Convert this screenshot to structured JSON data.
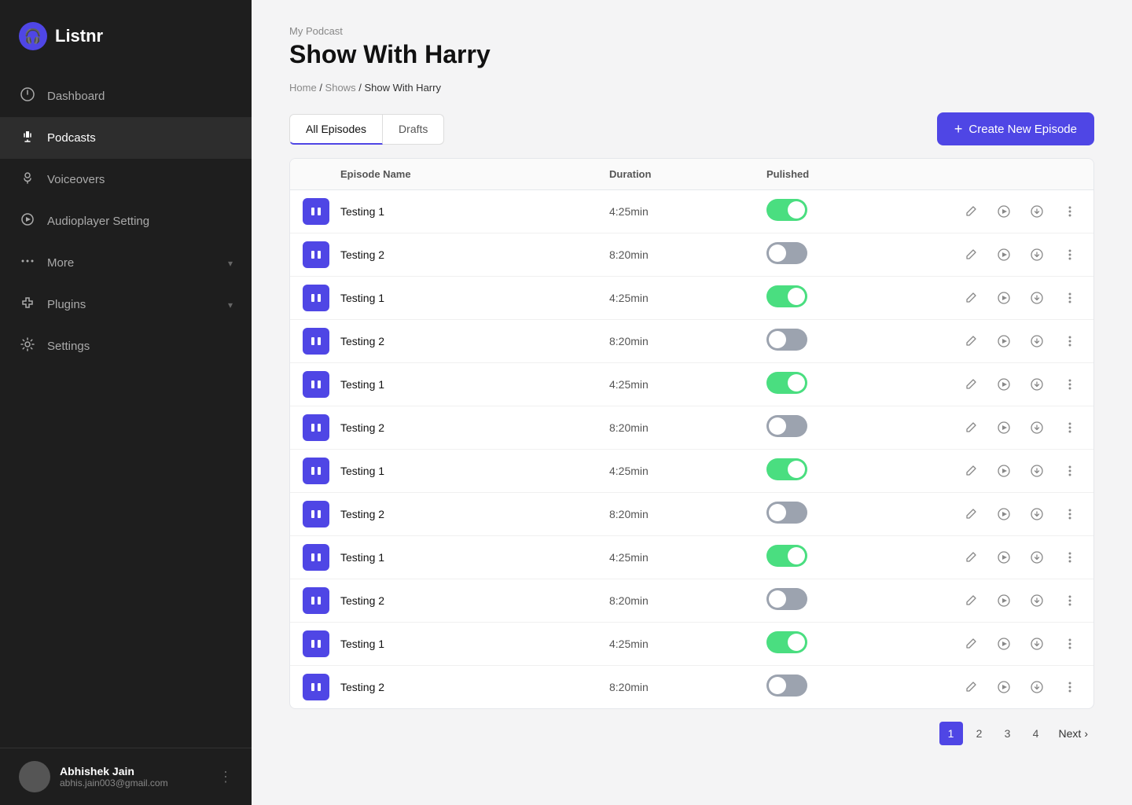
{
  "sidebar": {
    "logo": {
      "icon": "🎧",
      "name": "Listnr"
    },
    "nav_items": [
      {
        "id": "dashboard",
        "label": "Dashboard",
        "icon": "⬡",
        "active": false,
        "has_chevron": false
      },
      {
        "id": "podcasts",
        "label": "Podcasts",
        "icon": "♪",
        "active": true,
        "has_chevron": false
      },
      {
        "id": "voiceovers",
        "label": "Voiceovers",
        "icon": "🎙",
        "active": false,
        "has_chevron": false
      },
      {
        "id": "audioplayer",
        "label": "Audioplayer Setting",
        "icon": "▶",
        "active": false,
        "has_chevron": false
      },
      {
        "id": "more",
        "label": "More",
        "icon": "•••",
        "active": false,
        "has_chevron": true
      },
      {
        "id": "plugins",
        "label": "Plugins",
        "icon": "🔧",
        "active": false,
        "has_chevron": true
      },
      {
        "id": "settings",
        "label": "Settings",
        "icon": "⚙",
        "active": false,
        "has_chevron": false
      }
    ],
    "user": {
      "name": "Abhishek Jain",
      "email": "abhis.jain003@gmail.com"
    }
  },
  "header": {
    "podcast_label": "My Podcast",
    "page_title": "Show With Harry",
    "breadcrumb": {
      "home": "Home",
      "shows": "Shows",
      "current": "Show With Harry"
    }
  },
  "tabs": [
    {
      "id": "all_episodes",
      "label": "All Episodes",
      "active": true
    },
    {
      "id": "drafts",
      "label": "Drafts",
      "active": false
    }
  ],
  "create_button": {
    "label": "Create New Episode",
    "icon": "+"
  },
  "table": {
    "columns": [
      {
        "id": "icon",
        "label": ""
      },
      {
        "id": "name",
        "label": "Episode Name"
      },
      {
        "id": "duration",
        "label": "Duration"
      },
      {
        "id": "published",
        "label": "Pulished"
      },
      {
        "id": "actions",
        "label": ""
      }
    ],
    "rows": [
      {
        "id": 1,
        "name": "Testing 1",
        "duration": "4:25min",
        "published": true
      },
      {
        "id": 2,
        "name": "Testing 2",
        "duration": "8:20min",
        "published": false
      },
      {
        "id": 3,
        "name": "Testing 1",
        "duration": "4:25min",
        "published": true
      },
      {
        "id": 4,
        "name": "Testing 2",
        "duration": "8:20min",
        "published": false
      },
      {
        "id": 5,
        "name": "Testing 1",
        "duration": "4:25min",
        "published": true
      },
      {
        "id": 6,
        "name": "Testing 2",
        "duration": "8:20min",
        "published": false
      },
      {
        "id": 7,
        "name": "Testing 1",
        "duration": "4:25min",
        "published": true
      },
      {
        "id": 8,
        "name": "Testing 2",
        "duration": "8:20min",
        "published": false
      },
      {
        "id": 9,
        "name": "Testing 1",
        "duration": "4:25min",
        "published": true
      },
      {
        "id": 10,
        "name": "Testing 2",
        "duration": "8:20min",
        "published": false
      },
      {
        "id": 11,
        "name": "Testing 1",
        "duration": "4:25min",
        "published": true
      },
      {
        "id": 12,
        "name": "Testing 2",
        "duration": "8:20min",
        "published": false
      }
    ]
  },
  "pagination": {
    "pages": [
      "1",
      "2",
      "3",
      "4"
    ],
    "current": "1",
    "next_label": "Next"
  },
  "colors": {
    "sidebar_bg": "#1e1e1e",
    "accent": "#4f46e5",
    "toggle_on": "#4ade80",
    "toggle_off": "#9ca3af"
  }
}
